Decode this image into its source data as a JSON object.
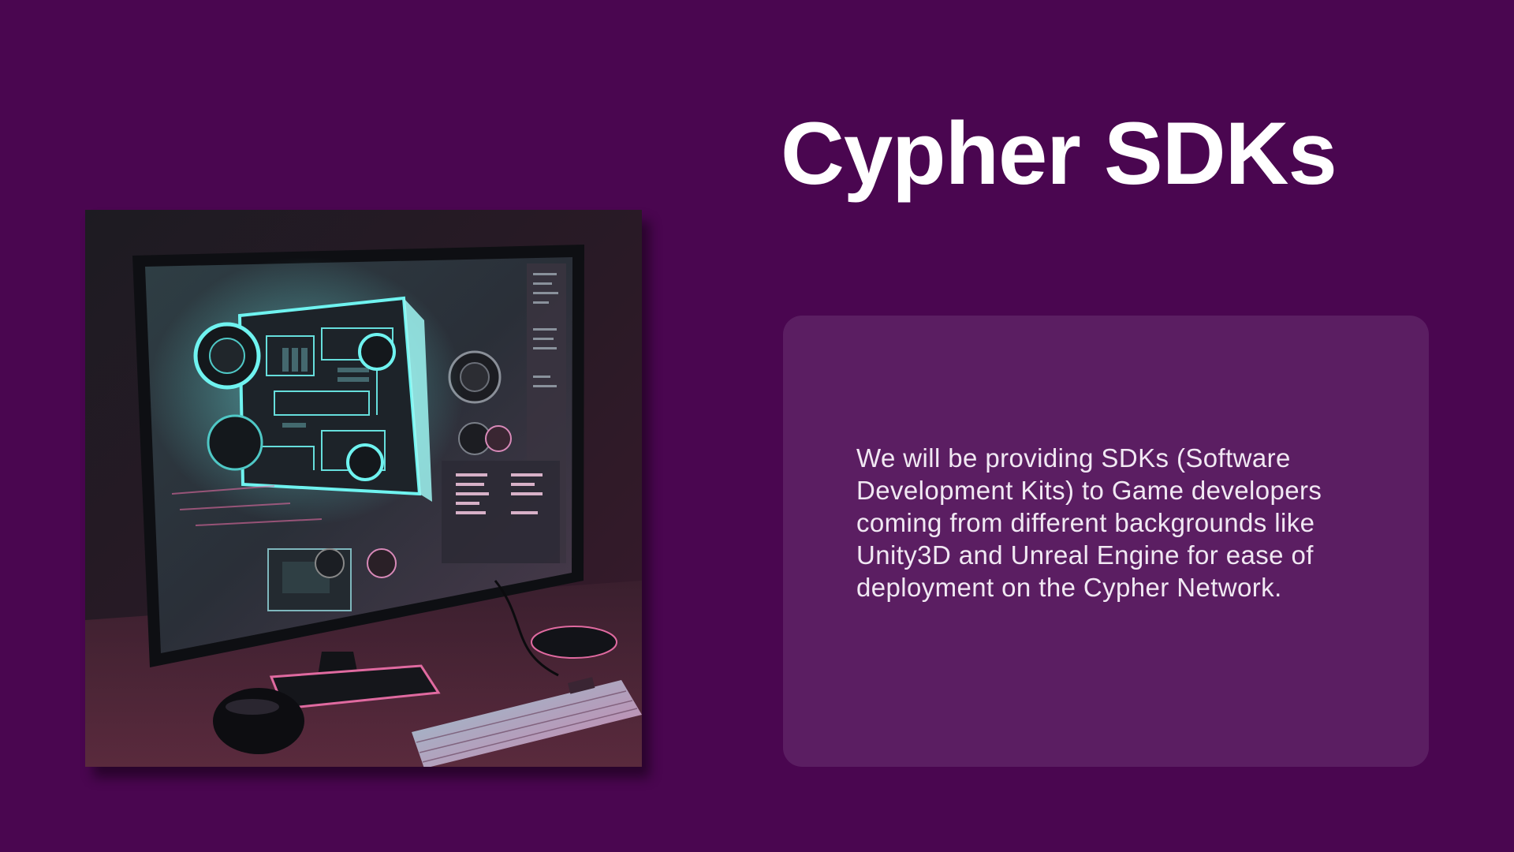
{
  "slide": {
    "title": "Cypher SDKs",
    "description": "We will be providing SDKs (Software Development Kits) to Game developers coming from different backgrounds like Unity3D and Unreal Engine for ease of deployment on the Cypher Network.",
    "image": {
      "subject": "desktop computer monitor showing a glowing holographic PC motherboard, with keyboard and mice on a desk"
    }
  },
  "colors": {
    "background": "#4a0650",
    "card": "#5b1e62",
    "title_text": "#ffffff",
    "body_text": "#f1e8f3",
    "neon_cyan": "#6ff3f0",
    "neon_pink": "#e06aa0"
  }
}
